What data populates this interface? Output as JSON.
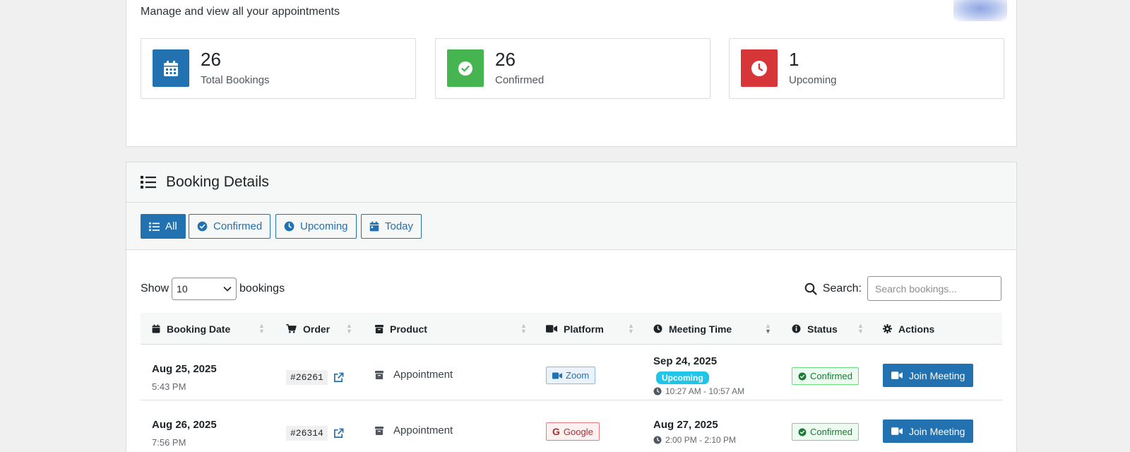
{
  "header": {
    "subtitle": "Manage and view all your appointments"
  },
  "stats": [
    {
      "value": "26",
      "label": "Total Bookings",
      "color": "#2271b1",
      "icon": "calendar-icon"
    },
    {
      "value": "26",
      "label": "Confirmed",
      "color": "#46b450",
      "icon": "check-circle-icon"
    },
    {
      "value": "1",
      "label": "Upcoming",
      "color": "#d63638",
      "icon": "clock-icon"
    }
  ],
  "booking_details": {
    "title": "Booking Details",
    "filters": [
      {
        "label": "All",
        "icon": "list-icon",
        "active": true
      },
      {
        "label": "Confirmed",
        "icon": "check-circle-icon",
        "active": false
      },
      {
        "label": "Upcoming",
        "icon": "clock-icon",
        "active": false
      },
      {
        "label": "Today",
        "icon": "calendar-icon",
        "active": false
      }
    ]
  },
  "table_controls": {
    "show_label": "Show",
    "page_size": "10",
    "bookings_label": "bookings",
    "search_label": "Search:",
    "search_placeholder": "Search bookings..."
  },
  "columns": [
    {
      "label": "Booking Date",
      "icon": "calendar-icon"
    },
    {
      "label": "Order",
      "icon": "cart-icon"
    },
    {
      "label": "Product",
      "icon": "box-icon"
    },
    {
      "label": "Platform",
      "icon": "video-icon"
    },
    {
      "label": "Meeting Time",
      "icon": "clock-icon"
    },
    {
      "label": "Status",
      "icon": "info-icon"
    },
    {
      "label": "Actions",
      "icon": "gear-icon"
    }
  ],
  "rows": [
    {
      "booking_date": "Aug 25, 2025",
      "booking_time": "5:43 PM",
      "order": "#26261",
      "product": "Appointment",
      "platform": "Zoom",
      "meeting_date": "Sep 24, 2025",
      "meeting_badge": "Upcoming",
      "meeting_range": "10:27 AM - 10:57 AM",
      "status": "Confirmed",
      "action": "Join Meeting"
    },
    {
      "booking_date": "Aug 26, 2025",
      "booking_time": "7:56 PM",
      "order": "#26314",
      "product": "Appointment",
      "platform": "Google",
      "meeting_date": "Aug 27, 2025",
      "meeting_badge": "",
      "meeting_range": "2:00 PM - 2:10 PM",
      "status": "Confirmed",
      "action": "Join Meeting"
    }
  ]
}
